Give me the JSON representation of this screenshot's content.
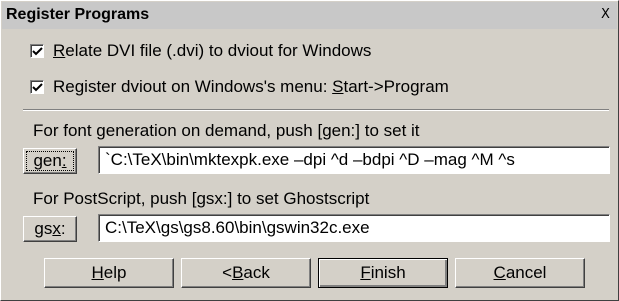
{
  "window": {
    "title": "Register Programs",
    "close_glyph": "X"
  },
  "checkboxes": [
    {
      "pre": "",
      "accel": "R",
      "post": "elate DVI file (.dvi) to dviout for Windows",
      "checked": true
    },
    {
      "pre": "Register dviout on Windows's menu: ",
      "accel": "S",
      "post": "tart->Program",
      "checked": true
    }
  ],
  "gen": {
    "label": "For font generation on demand, push [gen:] to set it",
    "button": {
      "pre": "gen",
      "accel": ":",
      "post": ""
    },
    "value": "`C:\\TeX\\bin\\mktexpk.exe –dpi ^d –bdpi ^D –mag ^M ^s"
  },
  "gsx": {
    "label": "For PostScript, push [gsx:] to set Ghostscript",
    "button": {
      "pre": "gs",
      "accel": "x",
      "post": ":"
    },
    "value": "C:\\TeX\\gs\\gs8.60\\bin\\gswin32c.exe"
  },
  "buttons": [
    {
      "id": "help",
      "pre": "",
      "accel": "H",
      "post": "elp"
    },
    {
      "id": "back",
      "pre": "< ",
      "accel": "B",
      "post": "ack"
    },
    {
      "id": "finish",
      "pre": "",
      "accel": "F",
      "post": "inish"
    },
    {
      "id": "cancel",
      "pre": "",
      "accel": "C",
      "post": "ancel"
    }
  ],
  "icons": {
    "checkbox": "check-mark-icon",
    "close": "close-icon"
  }
}
